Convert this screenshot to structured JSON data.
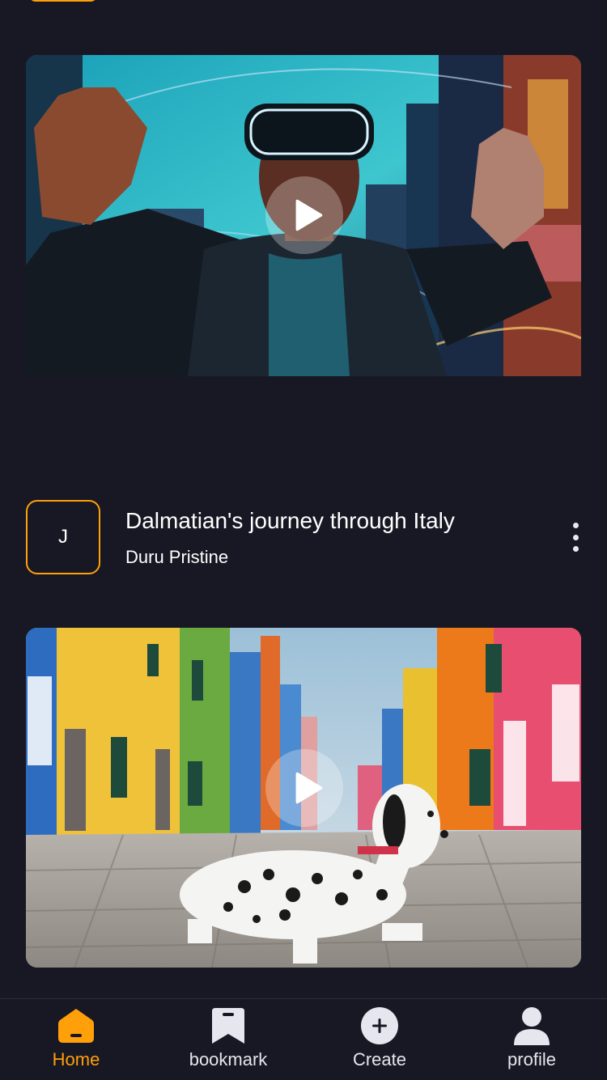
{
  "feed": {
    "post_1": {
      "thumbnail": "vr-headset-city-scene",
      "play_icon": "play-icon"
    },
    "post_2": {
      "avatar_initial": "J",
      "title": "Dalmatian's journey through Italy",
      "author": "Duru Pristine",
      "menu_icon": "more-vertical-icon",
      "thumbnail": "dalmatian-colorful-street-scene",
      "play_icon": "play-icon"
    }
  },
  "bottom_nav": {
    "items": [
      {
        "label": "Home",
        "icon": "home-icon",
        "active": true
      },
      {
        "label": "bookmark",
        "icon": "bookmark-icon",
        "active": false
      },
      {
        "label": "Create",
        "icon": "plus-circle-icon",
        "active": false
      },
      {
        "label": "profile",
        "icon": "profile-icon",
        "active": false
      }
    ]
  },
  "colors": {
    "background": "#181824",
    "accent": "#ff9f0a",
    "text": "#ffffff"
  }
}
